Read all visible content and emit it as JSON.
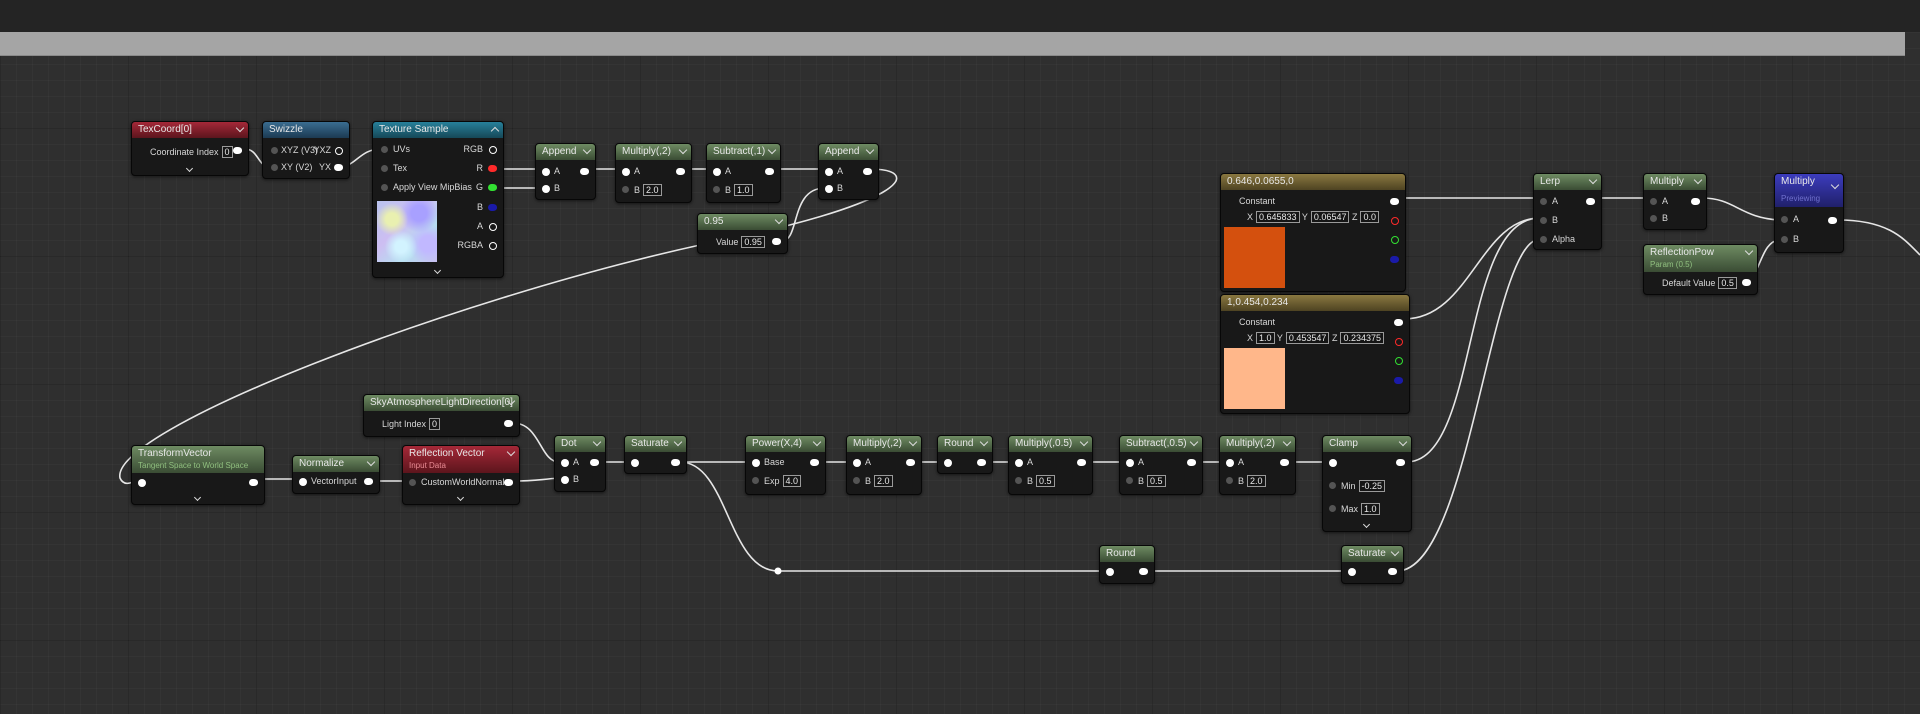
{
  "nodes": {
    "texcoord": {
      "title": "TexCoord[0]",
      "coordinate_index_label": "Coordinate Index",
      "coordinate_index": "0"
    },
    "swizzle": {
      "title": "Swizzle",
      "in_label": "XYZ (V3)",
      "in2_label": "XY (V2)",
      "out1_label": "YXZ",
      "out2_label": "YX"
    },
    "texture_sample": {
      "title": "Texture Sample",
      "uvs": "UVs",
      "tex": "Tex",
      "mip": "Apply View MipBias",
      "rgb": "RGB",
      "r": "R",
      "g": "G",
      "b": "B",
      "a": "A",
      "rgba": "RGBA"
    },
    "append1": {
      "title": "Append",
      "a": "A",
      "b": "B"
    },
    "multiply2a": {
      "title": "Multiply(,2)",
      "a": "A",
      "b": "B",
      "b_value": "2.0"
    },
    "subtract1": {
      "title": "Subtract(,1)",
      "a": "A",
      "b": "B",
      "b_value": "1.0"
    },
    "append2": {
      "title": "Append",
      "a": "A",
      "b": "B"
    },
    "const095": {
      "title": "0.95",
      "value_label": "Value",
      "value": "0.95"
    },
    "const_orange": {
      "title": "0.646,0.0655,0",
      "constant_label": "Constant",
      "x_label": "X",
      "x": "0.645833",
      "y_label": "Y",
      "y": "0.06547",
      "z_label": "Z",
      "z": "0.0",
      "color": "#d4500e"
    },
    "const_peach": {
      "title": "1,0.454,0.234",
      "constant_label": "Constant",
      "x_label": "X",
      "x": "1.0",
      "y_label": "Y",
      "y": "0.453547",
      "z_label": "Z",
      "z": "0.234375",
      "color": "#ffb78a"
    },
    "lerp": {
      "title": "Lerp",
      "a": "A",
      "b": "B",
      "alpha": "Alpha"
    },
    "multiply_top": {
      "title": "Multiply",
      "a": "A",
      "b": "B"
    },
    "multiply_preview": {
      "title": "Multiply",
      "subtitle": "Previewing",
      "a": "A",
      "b": "B"
    },
    "reflection_pow": {
      "title": "ReflectionPow",
      "subtitle": "Param (0.5)",
      "default_label": "Default Value",
      "default_value": "0.5"
    },
    "sky_light": {
      "title": "SkyAtmosphereLightDirection[0]",
      "light_index_label": "Light Index",
      "light_index": "0"
    },
    "transform_vector": {
      "title": "TransformVector",
      "subtitle": "Tangent Space to World Space"
    },
    "normalize": {
      "title": "Normalize",
      "input_label": "VectorInput"
    },
    "reflection_vector": {
      "title": "Reflection Vector",
      "subtitle": "Input Data",
      "input_label": "CustomWorldNormal"
    },
    "dot": {
      "title": "Dot",
      "a": "A",
      "b": "B"
    },
    "saturate1": {
      "title": "Saturate"
    },
    "power": {
      "title": "Power(X,4)",
      "base": "Base",
      "exp_label": "Exp",
      "exp": "4.0"
    },
    "multiply2b": {
      "title": "Multiply(,2)",
      "a": "A",
      "b": "B",
      "b_value": "2.0"
    },
    "round1": {
      "title": "Round"
    },
    "multiply05": {
      "title": "Multiply(,0.5)",
      "a": "A",
      "b": "B",
      "b_value": "0.5"
    },
    "subtract05": {
      "title": "Subtract(,0.5)",
      "a": "A",
      "b": "B",
      "b_value": "0.5"
    },
    "multiply2c": {
      "title": "Multiply(,2)",
      "a": "A",
      "b": "B",
      "b_value": "2.0"
    },
    "clamp": {
      "title": "Clamp",
      "min_label": "Min",
      "min": "-0.25",
      "max_label": "Max",
      "max": "1.0"
    },
    "round2": {
      "title": "Round"
    },
    "saturate2": {
      "title": "Saturate"
    }
  }
}
